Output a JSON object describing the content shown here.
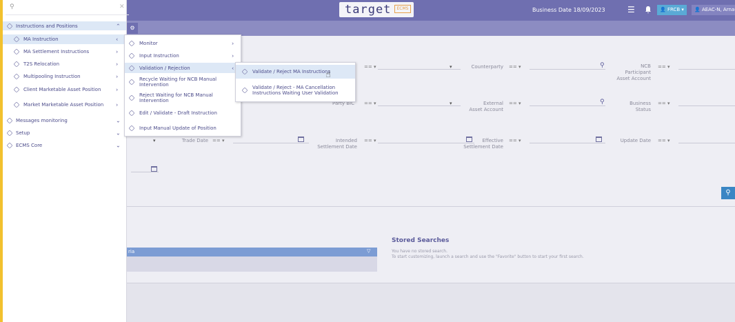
{
  "header": {
    "brand_word": "target",
    "brand_sub": "ECMS",
    "business_date": "Business Date 18/09/2023",
    "menu_icon": "hamburger-icon",
    "bell_icon": "bell-icon",
    "lang_button": "FRCB",
    "user_button": "AEAC-N, Arnaud"
  },
  "nav": {
    "search_icon": "search-icon",
    "search_placeholder": "",
    "items": [
      {
        "label": "Instructions and Positions",
        "chev": "⌃"
      },
      {
        "label": "MA Instruction",
        "chev": "‹"
      },
      {
        "label": "MA Settlement Instructions",
        "chev": "›"
      },
      {
        "label": "T2S Relocation",
        "chev": "›"
      },
      {
        "label": "Multipooling Instruction",
        "chev": "›"
      },
      {
        "label": "Client Marketable Asset Position",
        "chev": "›"
      },
      {
        "label": "Market Marketable Asset Position",
        "chev": "›"
      },
      {
        "label": "Messages monitoring",
        "chev": "⌄"
      },
      {
        "label": "Setup",
        "chev": "⌄"
      },
      {
        "label": "ECMS Core",
        "chev": "⌄"
      }
    ]
  },
  "menu2": {
    "items": [
      {
        "label": "Monitor",
        "chev": "›"
      },
      {
        "label": "Input Instruction",
        "chev": "›"
      },
      {
        "label": "Validation / Rejection",
        "chev": "‹"
      },
      {
        "label": "Recycle Waiting for NCB Manual Intervention",
        "chev": ""
      },
      {
        "label": "Reject Waiting for NCB Manual Intervention",
        "chev": ""
      },
      {
        "label": "Edit / Validate - Draft Instruction",
        "chev": ""
      },
      {
        "label": "Input Manual Update of Position",
        "chev": ""
      }
    ]
  },
  "menu3": {
    "items": [
      {
        "label": "Validate / Reject MA Instructions"
      },
      {
        "label": "Validate / Reject - MA Cancellation Instructions Waiting User Validation"
      }
    ]
  },
  "form": {
    "counterparty": "Counterparty",
    "ncb_participant": "NCB Participant Asset Account",
    "party_bic": "Party BIC",
    "external_asset": "External Asset Account",
    "business_status": "Business Status",
    "trade_date": "Trade Date",
    "intended_settlement": "Intended Settlement Date",
    "effective_settlement": "Effective Settlement Date",
    "update_date": "Update Date",
    "op": "== ▾"
  },
  "results": {
    "panel_text": "ria",
    "stored_title": "Stored Searches",
    "stored_line1": "You have no stored search.",
    "stored_line2": "To start customizing, launch a search and use the \"Favorite\" button to start your first search."
  }
}
